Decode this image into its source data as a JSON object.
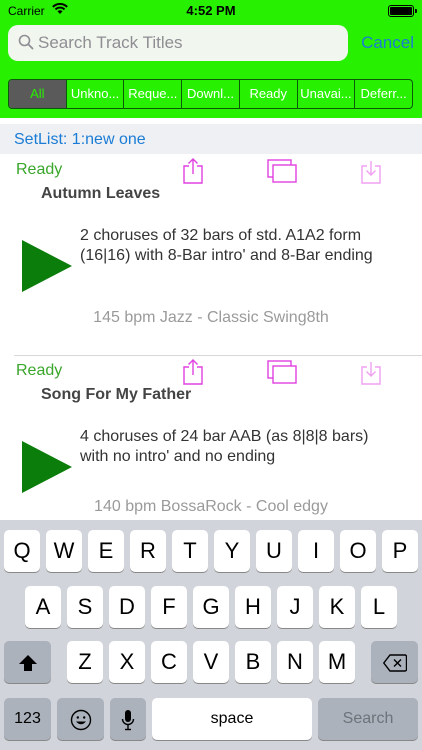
{
  "status_bar": {
    "carrier": "Carrier",
    "time": "4:52 PM"
  },
  "search": {
    "placeholder": "Search Track Titles",
    "value": "",
    "cancel_label": "Cancel"
  },
  "filters": [
    {
      "label": "All",
      "active": true
    },
    {
      "label": "Unkno...",
      "active": false
    },
    {
      "label": "Reque...",
      "active": false
    },
    {
      "label": "Downl...",
      "active": false
    },
    {
      "label": "Ready",
      "active": false
    },
    {
      "label": "Unavai...",
      "active": false
    },
    {
      "label": "Deferr...",
      "active": false
    }
  ],
  "setlist": {
    "label": "SetList: 1:new one"
  },
  "tracks": [
    {
      "status": "Ready",
      "title": "Autumn Leaves",
      "description": "2 choruses of 32 bars of std. A1A2 form (16|16) with 8-Bar intro' and 8-Bar ending",
      "meta": "145 bpm Jazz - Classic Swing8th"
    },
    {
      "status": "Ready",
      "title": "Song For My Father",
      "description": "4 choruses of 24 bar AAB (as 8|8|8 bars) with no intro' and no ending",
      "meta": "140 bpm BossaRock - Cool edgy"
    }
  ],
  "icons": {
    "share": "share-icon",
    "copy": "copy-icon",
    "download": "download-icon",
    "play": "play-icon",
    "search": "search-icon"
  },
  "colors": {
    "header_green": "#27f000",
    "ready_green": "#3aa62b",
    "play_green": "#0a7d0a",
    "link_blue": "#1b7cd6",
    "action_magenta": "#e040e0"
  },
  "keyboard": {
    "row1": [
      "Q",
      "W",
      "E",
      "R",
      "T",
      "Y",
      "U",
      "I",
      "O",
      "P"
    ],
    "row2": [
      "A",
      "S",
      "D",
      "F",
      "G",
      "H",
      "J",
      "K",
      "L"
    ],
    "row3": [
      "Z",
      "X",
      "C",
      "V",
      "B",
      "N",
      "M"
    ],
    "numbers_label": "123",
    "space_label": "space",
    "search_label": "Search"
  }
}
